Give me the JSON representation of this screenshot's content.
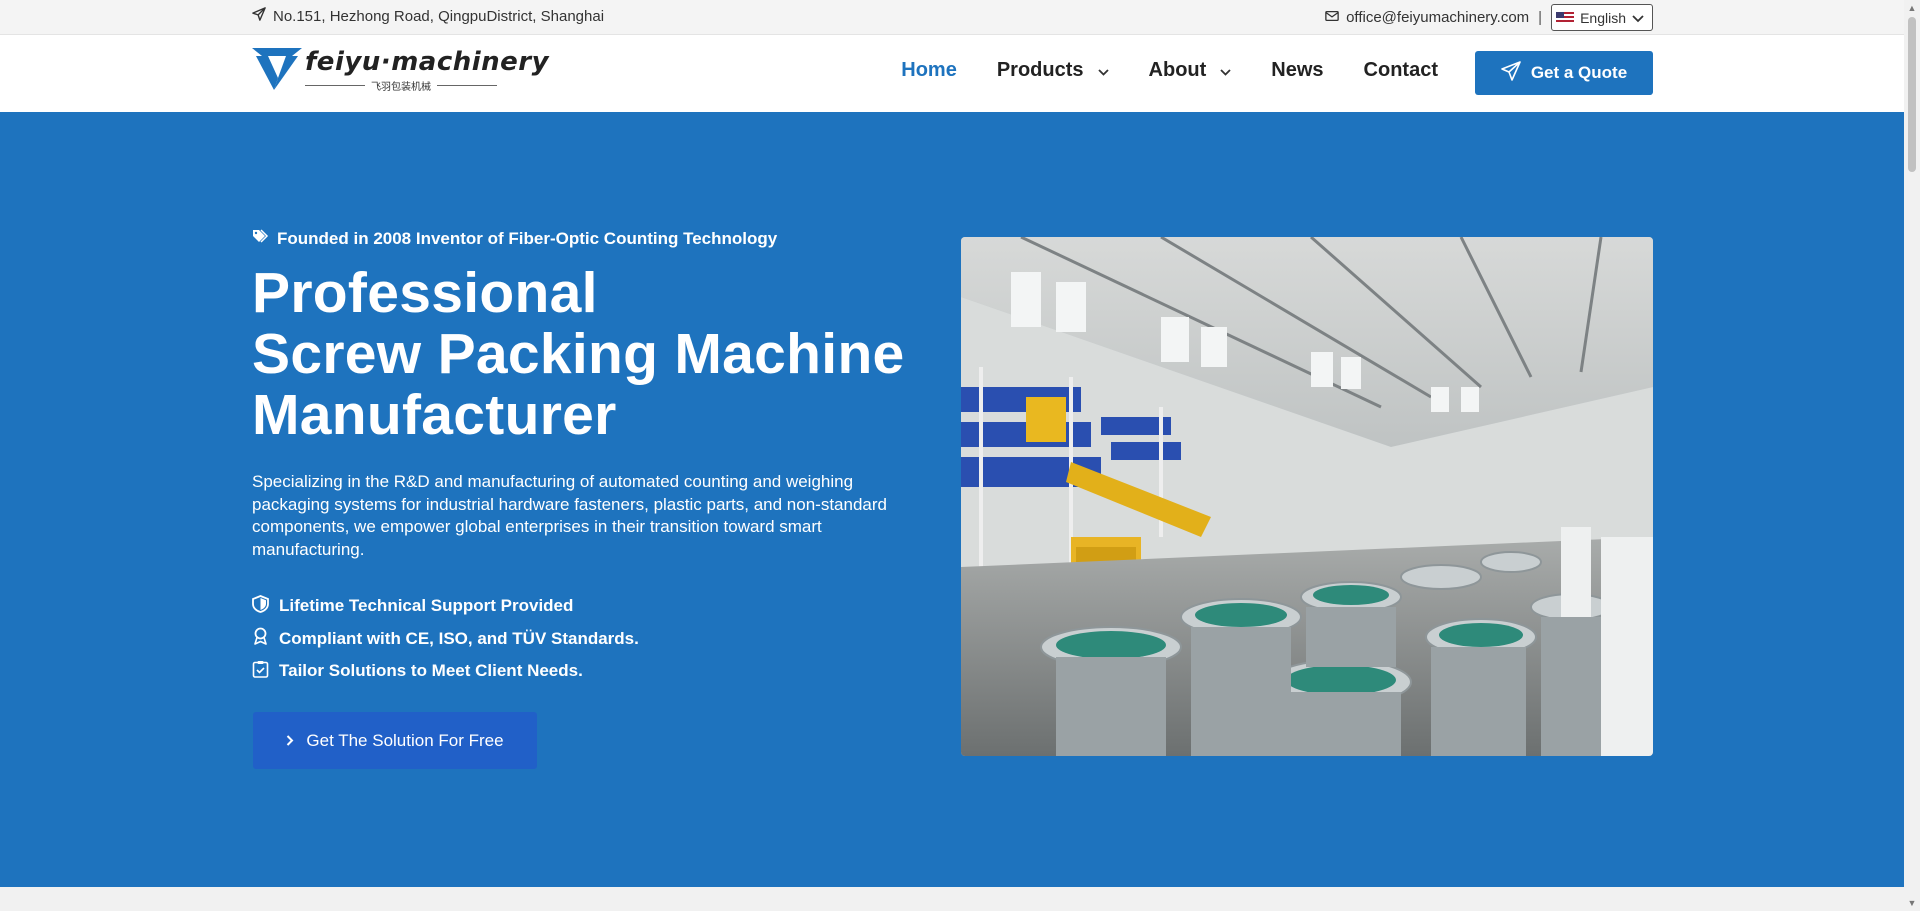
{
  "topbar": {
    "address": "No.151, Hezhong Road, QingpuDistrict, Shanghai",
    "email": "office@feiyumachinery.com",
    "separator": "|",
    "language": "English"
  },
  "header": {
    "logo": {
      "wordmark": "feiyu·machinery",
      "subtitle": "飞羽包装机械"
    },
    "nav": [
      {
        "label": "Home",
        "active": true
      },
      {
        "label": "Products",
        "has_dropdown": true
      },
      {
        "label": "About",
        "has_dropdown": true
      },
      {
        "label": "News"
      },
      {
        "label": "Contact"
      }
    ],
    "quote_button": "Get a Quote"
  },
  "hero": {
    "tagline": "Founded in 2008 Inventor of Fiber-Optic Counting Technology",
    "title_lines": [
      "Professional",
      "Screw Packing Machine",
      "Manufacturer"
    ],
    "description": "Specializing in the R&D and manufacturing of automated counting and weighing packaging systems for industrial hardware fasteners, plastic parts, and non-standard components, we empower global enterprises in their transition toward smart manufacturing.",
    "features": [
      {
        "icon": "shield-icon",
        "text": "Lifetime Technical Support Provided"
      },
      {
        "icon": "award-icon",
        "text": "Compliant with CE, ISO, and TÜV Standards."
      },
      {
        "icon": "clipboard-check-icon",
        "text": "Tailor Solutions to Meet Client Needs."
      }
    ],
    "cta_button": "Get The Solution For Free",
    "image": "factory-floor-photo"
  },
  "colors": {
    "primary": "#1e73be",
    "cta": "#2160c8",
    "topbar_bg": "#f4f4f4",
    "text_dark": "#222222"
  }
}
